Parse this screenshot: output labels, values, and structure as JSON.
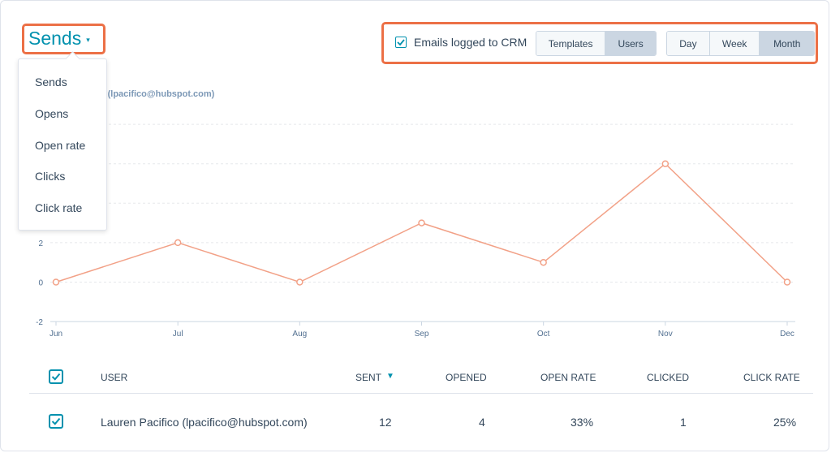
{
  "metric_selector": {
    "label": "Sends",
    "caret": "▾"
  },
  "dropdown": {
    "items": [
      "Sends",
      "Opens",
      "Open rate",
      "Clicks",
      "Click rate"
    ]
  },
  "legend": {
    "label": "fico (lpacifico@hubspot.com)"
  },
  "filters": {
    "crm_checkbox": {
      "label": "Emails logged to CRM",
      "checked": true
    },
    "view_toggle": {
      "options": [
        "Templates",
        "Users"
      ],
      "active": "Users"
    },
    "period_toggle": {
      "options": [
        "Day",
        "Week",
        "Month"
      ],
      "active": "Month"
    }
  },
  "colors": {
    "accent": "#0091ae",
    "line": "#f2a187",
    "highlight": "#ec7046"
  },
  "chart_data": {
    "type": "line",
    "categories": [
      "Jun",
      "Jul",
      "Aug",
      "Sep",
      "Oct",
      "Nov",
      "Dec"
    ],
    "values": [
      0,
      2,
      0,
      3,
      1,
      6,
      0
    ],
    "y_ticks": [
      "2",
      "0",
      "-2"
    ],
    "ylim": [
      -2,
      8
    ],
    "grid": true
  },
  "table": {
    "headers": {
      "user": "USER",
      "sent": "SENT",
      "opened": "OPENED",
      "open_rate": "OPEN RATE",
      "clicked": "CLICKED",
      "click_rate": "CLICK RATE"
    },
    "sort_indicator": "▼",
    "rows": [
      {
        "user": "Lauren Pacifico (lpacifico@hubspot.com)",
        "sent": "12",
        "opened": "4",
        "open_rate": "33%",
        "clicked": "1",
        "click_rate": "25%"
      }
    ]
  }
}
